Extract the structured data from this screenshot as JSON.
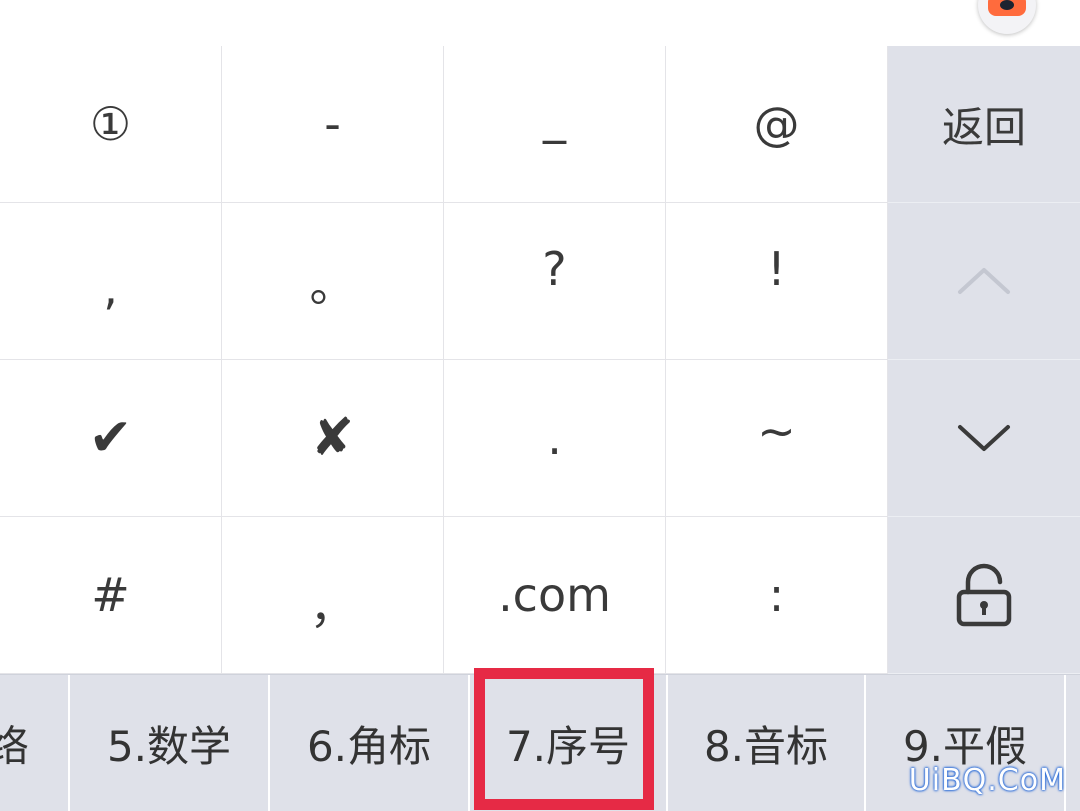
{
  "symbol_keys": [
    [
      "①",
      "-",
      "_",
      "@"
    ],
    [
      ",",
      "。",
      "?",
      "!"
    ],
    [
      "✔",
      "✘",
      ".",
      "~"
    ],
    [
      "#",
      "，",
      ".com",
      ":"
    ]
  ],
  "sidebar": {
    "back_label": "返回",
    "up_icon": "chevron-up-icon",
    "down_icon": "chevron-down-icon",
    "lock_icon": "unlock-icon"
  },
  "categories": [
    "络",
    "5.数学",
    "6.角标",
    "7.序号",
    "8.音标",
    "9.平假"
  ],
  "selected_category": "7.序号",
  "colors": {
    "highlight": "#e62a45",
    "panel": "#dfe1e9",
    "disabled_icon": "#c4c7d1"
  },
  "watermark": "UiBQ.CoM"
}
